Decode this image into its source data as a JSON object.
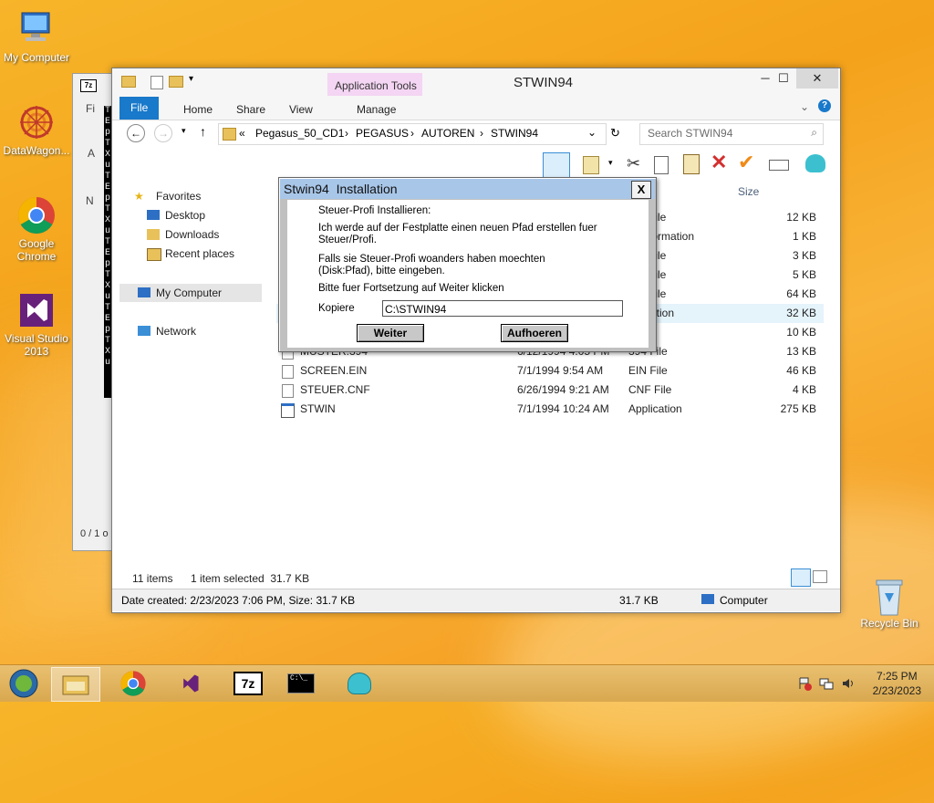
{
  "desktop": {
    "icons": [
      {
        "label": "My Computer"
      },
      {
        "label": "DataWagon..."
      },
      {
        "label": "Google Chrome"
      },
      {
        "label": "Visual Studio 2013"
      },
      {
        "label": "Recycle Bin"
      }
    ]
  },
  "background_window": {
    "title_glyph": "7z",
    "label_fi": "Fi",
    "label_a": "A",
    "label_n": "N",
    "status": "0 / 1 o"
  },
  "terminal_strip": {
    "text": "TEpTXuTEpTXuTEpTXuTEpTXu"
  },
  "explorer": {
    "title": "STWIN94",
    "app_tools": "Application Tools",
    "tabs": [
      "File",
      "Home",
      "Share",
      "View",
      "Manage"
    ],
    "breadcrumb": [
      "«",
      "Pegasus_50_CD1",
      "PEGASUS",
      "AUTOREN",
      "STWIN94"
    ],
    "search_placeholder": "Search STWIN94",
    "column_size": "Size",
    "nav": {
      "favorites": "Favorites",
      "desktop": "Desktop",
      "downloads": "Downloads",
      "recent": "Recent places",
      "my_computer": "My Computer",
      "network": "Network"
    },
    "files": [
      {
        "name": "",
        "date": "",
        "type": "File",
        "size": "12 KB"
      },
      {
        "name": "",
        "date": "",
        "type": "Information",
        "size": "1 KB"
      },
      {
        "name": "",
        "date": "",
        "type": "File",
        "size": "3 KB"
      },
      {
        "name": "",
        "date": "",
        "type": "File",
        "size": "5 KB"
      },
      {
        "name": "",
        "date": "",
        "type": "File",
        "size": "64 KB"
      },
      {
        "name": "",
        "date": "",
        "type": "cation",
        "size": "32 KB"
      },
      {
        "name": "",
        "date": "",
        "type": "",
        "size": "10 KB"
      },
      {
        "name": "MUSTER.394",
        "date": "6/12/1994 4:05 PM",
        "type": "394 File",
        "size": "13 KB"
      },
      {
        "name": "SCREEN.EIN",
        "date": "7/1/1994 9:54 AM",
        "type": "EIN File",
        "size": "46 KB"
      },
      {
        "name": "STEUER.CNF",
        "date": "6/26/1994 9:21 AM",
        "type": "CNF File",
        "size": "4 KB"
      },
      {
        "name": "STWIN",
        "date": "7/1/1994 10:24 AM",
        "type": "Application",
        "size": "275 KB"
      }
    ],
    "status_items": "11 items",
    "status_selected": "1 item selected  31.7 KB",
    "details_created": "Date created: 2/23/2023 7:06 PM, Size: 31.7 KB",
    "details_size": "31.7 KB",
    "details_location": "Computer"
  },
  "dialog": {
    "title": "Stwin94  Installation",
    "close": "X",
    "line1": "Steuer-Profi Installieren:",
    "line2": "Ich werde auf der Festplatte einen neuen Pfad erstellen fuer",
    "line3": "Steuer/Profi.",
    "line4": "Falls sie Steuer-Profi woanders haben moechten",
    "line5": "(Disk:Pfad), bitte eingeben.",
    "line6": "Bitte fuer Fortsetzung auf Weiter klicken",
    "kopiere_label": "Kopiere",
    "kopiere_value": "C:\\STWIN94",
    "weiter": "Weiter",
    "aufhoeren": "Aufhoeren"
  },
  "taskbar": {
    "time": "7:25 PM",
    "date": "2/23/2023",
    "sevenzip": "7z",
    "cmd": "C:\\_"
  }
}
